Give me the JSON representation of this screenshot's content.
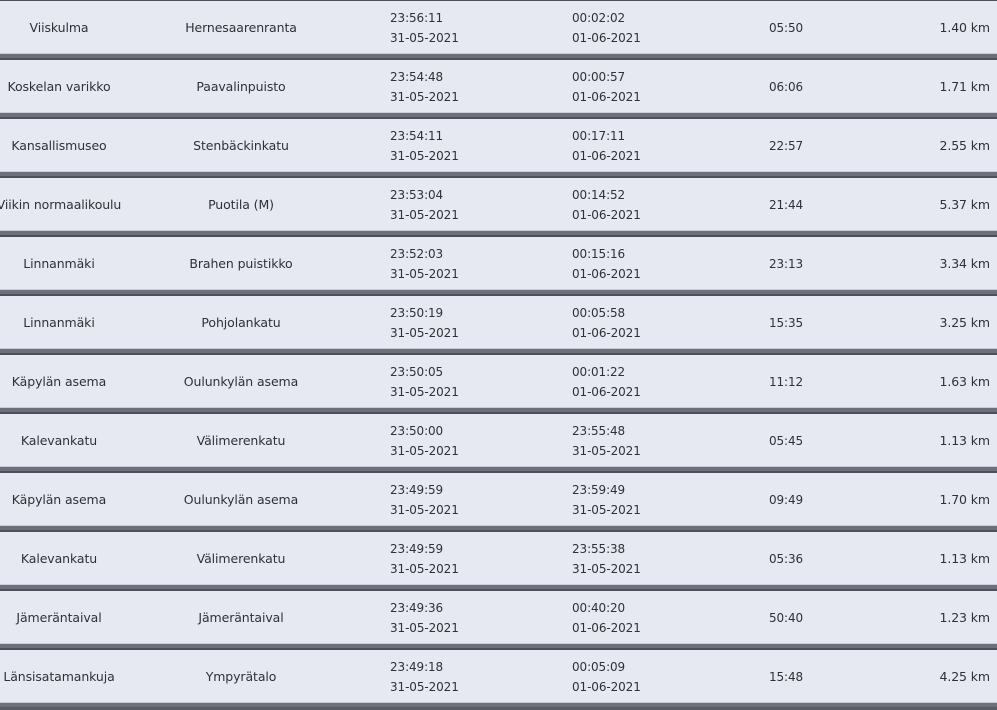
{
  "trips": [
    {
      "departure": "Viiskulma",
      "return": "Hernesaarenranta",
      "departure_time": "23:56:11",
      "departure_date": "31-05-2021",
      "return_time": "00:02:02",
      "return_date": "01-06-2021",
      "duration": "05:50",
      "distance": "1.40 km"
    },
    {
      "departure": "Koskelan varikko",
      "return": "Paavalinpuisto",
      "departure_time": "23:54:48",
      "departure_date": "31-05-2021",
      "return_time": "00:00:57",
      "return_date": "01-06-2021",
      "duration": "06:06",
      "distance": "1.71 km"
    },
    {
      "departure": "Kansallismuseo",
      "return": "Stenbäckinkatu",
      "departure_time": "23:54:11",
      "departure_date": "31-05-2021",
      "return_time": "00:17:11",
      "return_date": "01-06-2021",
      "duration": "22:57",
      "distance": "2.55 km"
    },
    {
      "departure": "Viikin normaalikoulu",
      "return": "Puotila (M)",
      "departure_time": "23:53:04",
      "departure_date": "31-05-2021",
      "return_time": "00:14:52",
      "return_date": "01-06-2021",
      "duration": "21:44",
      "distance": "5.37 km"
    },
    {
      "departure": "Linnanmäki",
      "return": "Brahen puistikko",
      "departure_time": "23:52:03",
      "departure_date": "31-05-2021",
      "return_time": "00:15:16",
      "return_date": "01-06-2021",
      "duration": "23:13",
      "distance": "3.34 km"
    },
    {
      "departure": "Linnanmäki",
      "return": "Pohjolankatu",
      "departure_time": "23:50:19",
      "departure_date": "31-05-2021",
      "return_time": "00:05:58",
      "return_date": "01-06-2021",
      "duration": "15:35",
      "distance": "3.25 km"
    },
    {
      "departure": "Käpylän asema",
      "return": "Oulunkylän asema",
      "departure_time": "23:50:05",
      "departure_date": "31-05-2021",
      "return_time": "00:01:22",
      "return_date": "01-06-2021",
      "duration": "11:12",
      "distance": "1.63 km"
    },
    {
      "departure": "Kalevankatu",
      "return": "Välimerenkatu",
      "departure_time": "23:50:00",
      "departure_date": "31-05-2021",
      "return_time": "23:55:48",
      "return_date": "31-05-2021",
      "duration": "05:45",
      "distance": "1.13 km"
    },
    {
      "departure": "Käpylän asema",
      "return": "Oulunkylän asema",
      "departure_time": "23:49:59",
      "departure_date": "31-05-2021",
      "return_time": "23:59:49",
      "return_date": "31-05-2021",
      "duration": "09:49",
      "distance": "1.70 km"
    },
    {
      "departure": "Kalevankatu",
      "return": "Välimerenkatu",
      "departure_time": "23:49:59",
      "departure_date": "31-05-2021",
      "return_time": "23:55:38",
      "return_date": "31-05-2021",
      "duration": "05:36",
      "distance": "1.13 km"
    },
    {
      "departure": "Jämeräntaival",
      "return": "Jämeräntaival",
      "departure_time": "23:49:36",
      "departure_date": "31-05-2021",
      "return_time": "00:40:20",
      "return_date": "01-06-2021",
      "duration": "50:40",
      "distance": "1.23 km"
    },
    {
      "departure": "Länsisatamankuja",
      "return": "Ympyrätalo",
      "departure_time": "23:49:18",
      "departure_date": "31-05-2021",
      "return_time": "00:05:09",
      "return_date": "01-06-2021",
      "duration": "15:48",
      "distance": "4.25 km"
    }
  ]
}
